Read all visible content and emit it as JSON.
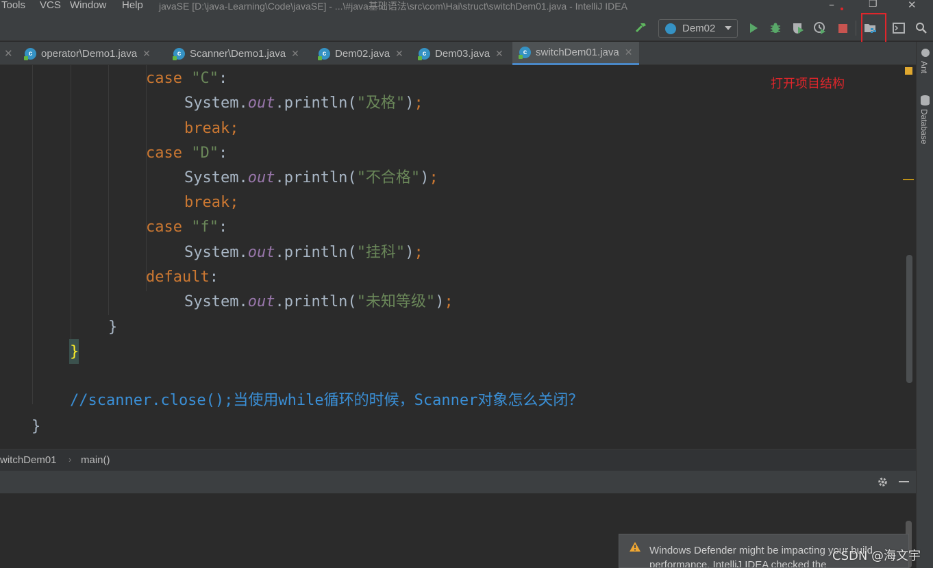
{
  "menu": {
    "items": [
      "Tools",
      "VCS",
      "Window",
      "Help"
    ]
  },
  "window": {
    "title": "javaSE [D:\\java-Learning\\Code\\javaSE] - ...\\#java基础语法\\src\\com\\Hai\\struct\\switchDem01.java - IntelliJ IDEA",
    "controls": {
      "minimize": "–",
      "restore": "❐",
      "close": "✕"
    }
  },
  "toolbar": {
    "run_config": "Dem02",
    "icons": [
      "build-hammer-icon",
      "run-icon",
      "debug-icon",
      "coverage-icon",
      "profile-icon",
      "stop-icon",
      "project-structure-icon",
      "terminal-icon",
      "search-icon"
    ]
  },
  "tabs": [
    {
      "label": "operator\\Demo1.java",
      "active": false
    },
    {
      "label": "Scanner\\Demo1.java",
      "active": false
    },
    {
      "label": "Dem02.java",
      "active": false
    },
    {
      "label": "Dem03.java",
      "active": false
    },
    {
      "label": "switchDem01.java",
      "active": true
    }
  ],
  "right_strip": {
    "ant": "Ant",
    "database": "Database"
  },
  "annotation": "打开项目结构",
  "code": {
    "case_c": "case",
    "case_c_val": "\"C\"",
    "sys": "System.",
    "out": "out",
    "println": ".println(",
    "str_pass": "\"及格\"",
    "str_fail": "\"不合格\"",
    "str_retake": "\"挂科\"",
    "str_unknown": "\"未知等级\"",
    "brk": "break;",
    "case_d_val": "\"D\"",
    "case_f_val": "\"f\"",
    "dflt": "default",
    "close_paren": ")",
    "semicolon": ";",
    "colon": ":",
    "close_brace": "}",
    "comment": "//scanner.close();当使用while循环的时候，Scanner对象怎么关闭？"
  },
  "breadcrumb": {
    "class_name": "witchDem01",
    "separator": "›",
    "method": "main()"
  },
  "notification": {
    "text": "Windows Defender might be impacting your build performance. IntelliJ IDEA checked the"
  },
  "watermark": "CSDN @海文宇"
}
